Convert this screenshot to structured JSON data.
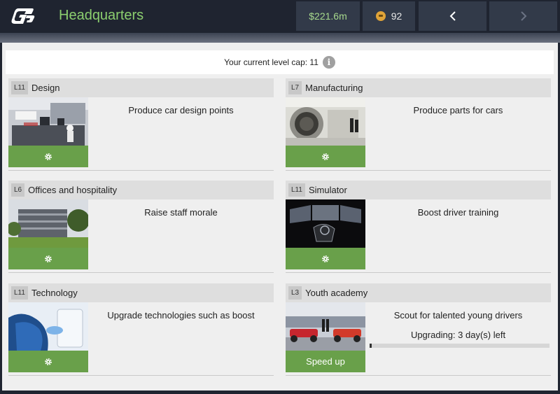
{
  "header": {
    "title": "Headquarters",
    "money": "$221.6m",
    "tokens": "92",
    "prev_icon": "chevron-left-icon",
    "next_icon": "chevron-right-icon",
    "logo_icon": "gp-logo-icon"
  },
  "level_cap": {
    "text": "Your current level cap: 11",
    "icon": "info-icon",
    "glyph": "i"
  },
  "colors": {
    "accent_green": "#69a04a",
    "title_green": "#8ccf6f",
    "topbar_bg": "#1f2430",
    "button_bg": "#323a49"
  },
  "facilities": [
    {
      "level": "L11",
      "name": "Design",
      "description": "Produce car design points",
      "action_icon": "gear-icon"
    },
    {
      "level": "L7",
      "name": "Manufacturing",
      "description": "Produce parts for cars",
      "action_icon": "gear-icon"
    },
    {
      "level": "L6",
      "name": "Offices and hospitality",
      "description": "Raise staff morale",
      "action_icon": "gear-icon"
    },
    {
      "level": "L11",
      "name": "Simulator",
      "description": "Boost driver training",
      "action_icon": "gear-icon"
    },
    {
      "level": "L11",
      "name": "Technology",
      "description": "Upgrade technologies such as boost",
      "action_icon": "gear-icon"
    },
    {
      "level": "L3",
      "name": "Youth academy",
      "description": "Scout for talented young drivers",
      "action_label": "Speed up",
      "status": "Upgrading: 3 day(s) left",
      "progress": 0.01
    }
  ]
}
